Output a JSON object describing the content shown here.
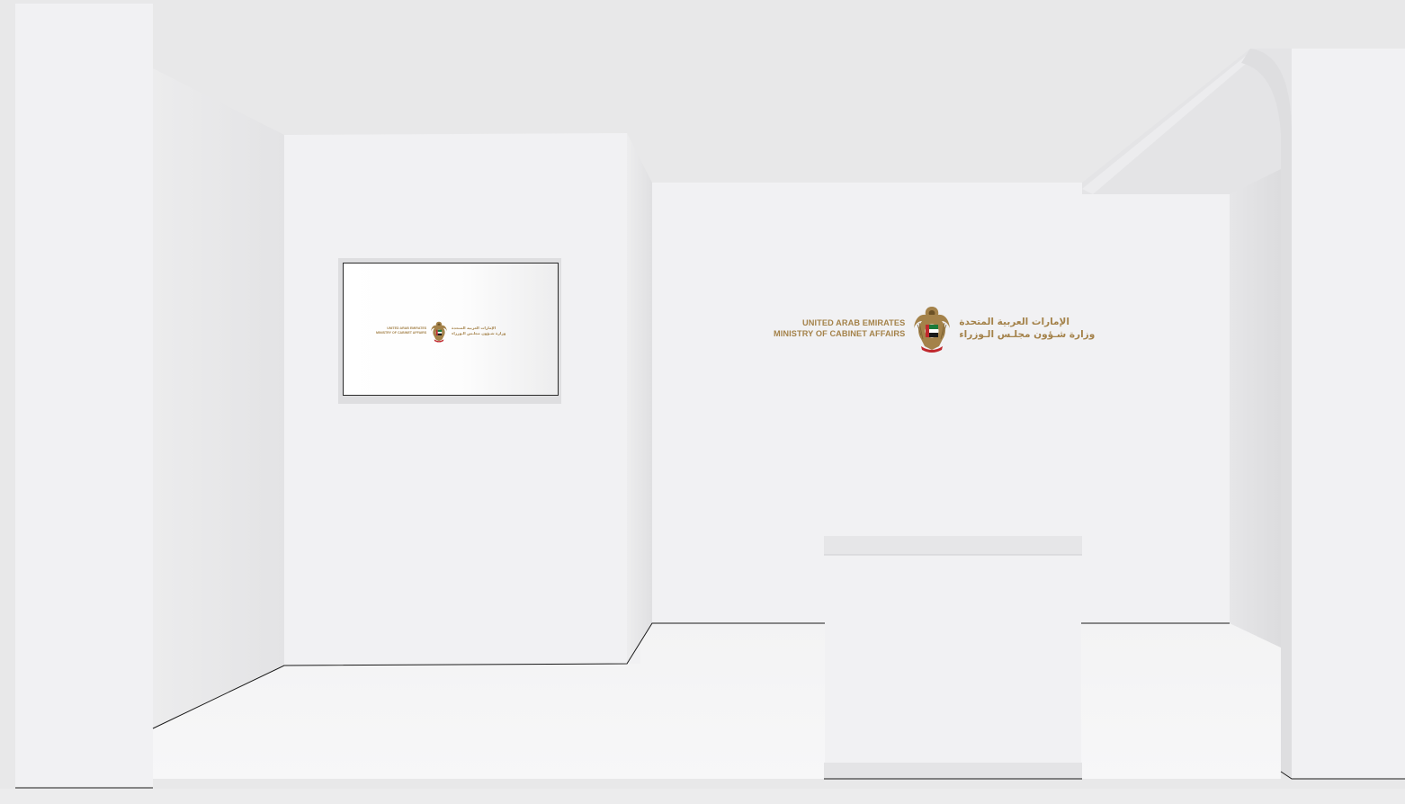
{
  "booth": {
    "wall_logo": {
      "line1_en": "UNITED ARAB EMIRATES",
      "line2_en": "MINISTRY OF CABINET AFFAIRS",
      "line1_ar": "الإمارات العربية المتحدة",
      "line2_ar": "وزارة شـؤون مجلـس الـوزراء",
      "emblem_icon": "uae-falcon-emblem-icon"
    },
    "screen_logo": {
      "line1_en": "UNITED ARAB EMIRATES",
      "line2_en": "MINISTRY OF CABINET AFFAIRS",
      "line1_ar": "الإمارات العربية المتحدة",
      "line2_ar": "وزارة شـؤون مجلـس الـوزراء",
      "emblem_icon": "uae-falcon-emblem-icon"
    },
    "colors": {
      "background": "#e8e8e9",
      "wall": "#f1f1f3",
      "floor": "#f4f4f5",
      "outline": "#1a1a1a",
      "logo_gold": "#a4824a",
      "emblem_red": "#c0282d",
      "emblem_green": "#1b7a3a"
    }
  }
}
